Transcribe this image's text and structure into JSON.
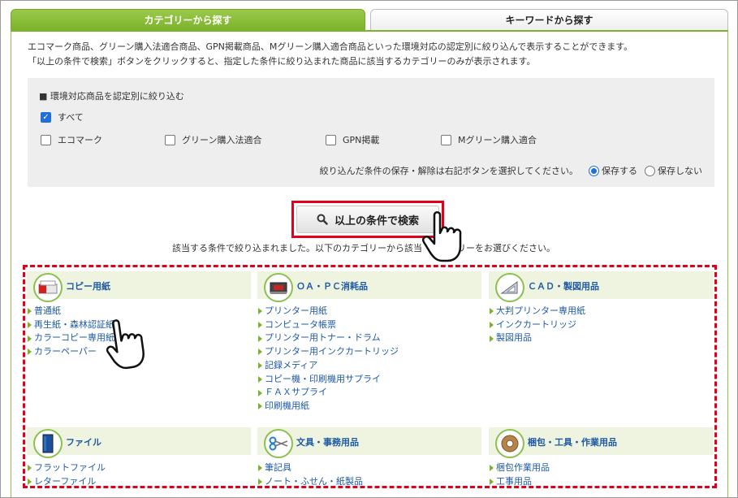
{
  "tabs": {
    "category": "カテゴリーから探す",
    "keyword": "キーワードから探す"
  },
  "description": {
    "line1": "エコマーク商品、グリーン購入法適合商品、GPN掲載商品、Mグリーン購入適合商品といった環境対応の認定別に絞り込んで表示することができます。",
    "line2": "「以上の条件で検索」ボタンをクリックすると、指定した条件に絞り込まれた商品に該当するカテゴリーのみが表示されます。"
  },
  "filter": {
    "title": "■ 環境対応商品を認定別に絞り込む",
    "all": {
      "label": "すべて",
      "checked": true
    },
    "options": [
      {
        "label": "エコマーク",
        "checked": false
      },
      {
        "label": "グリーン購入法適合",
        "checked": false
      },
      {
        "label": "GPN掲載",
        "checked": false
      },
      {
        "label": "Mグリーン購入適合",
        "checked": false
      }
    ],
    "save_note": "絞り込んだ条件の保存・解除は右記ボタンを選択してください。",
    "save_on": "保存する",
    "save_off": "保存しない",
    "save_selected": "保存する"
  },
  "search_button": "以上の条件で検索",
  "result_message_left": "該当する条件で絞り込まれました。以下のカテゴリーから該当",
  "result_message_right": "リーをお選びください。",
  "categories": [
    {
      "title": "コピー用紙",
      "icon": "copy-paper-icon",
      "items": [
        "普通紙",
        "再生紙・森林認証紙",
        "カラーコピー専用紙",
        "カラーペーパー"
      ]
    },
    {
      "title": "ＯＡ・ＰＣ消耗品",
      "icon": "oa-supplies-icon",
      "items": [
        "プリンター用紙",
        "コンピュータ帳票",
        "プリンター用トナー・ドラム",
        "プリンター用インクカートリッジ",
        "記録メディア",
        "コピー機・印刷機用サプライ",
        "ＦＡＸサプライ",
        "印刷機用紙"
      ]
    },
    {
      "title": "ＣＡＤ・製図用品",
      "icon": "drafting-icon",
      "items": [
        "大判プリンター専用紙",
        "インクカートリッジ",
        "製図用品"
      ]
    },
    {
      "title": "ファイル",
      "icon": "file-binder-icon",
      "items": [
        "フラットファイル",
        "レターファイル"
      ]
    },
    {
      "title": "文具・事務用品",
      "icon": "scissors-icon",
      "items": [
        "筆記具",
        "ノート・ふせん・紙製品"
      ]
    },
    {
      "title": "梱包・工具・作業用品",
      "icon": "packing-tape-icon",
      "items": [
        "梱包作業用品",
        "工事用品"
      ]
    }
  ],
  "colors": {
    "accent_green": "#7cb32c",
    "highlight_red": "#e0001b",
    "link_blue": "#1f5aa6",
    "checkbox_blue": "#1e6fd9"
  }
}
